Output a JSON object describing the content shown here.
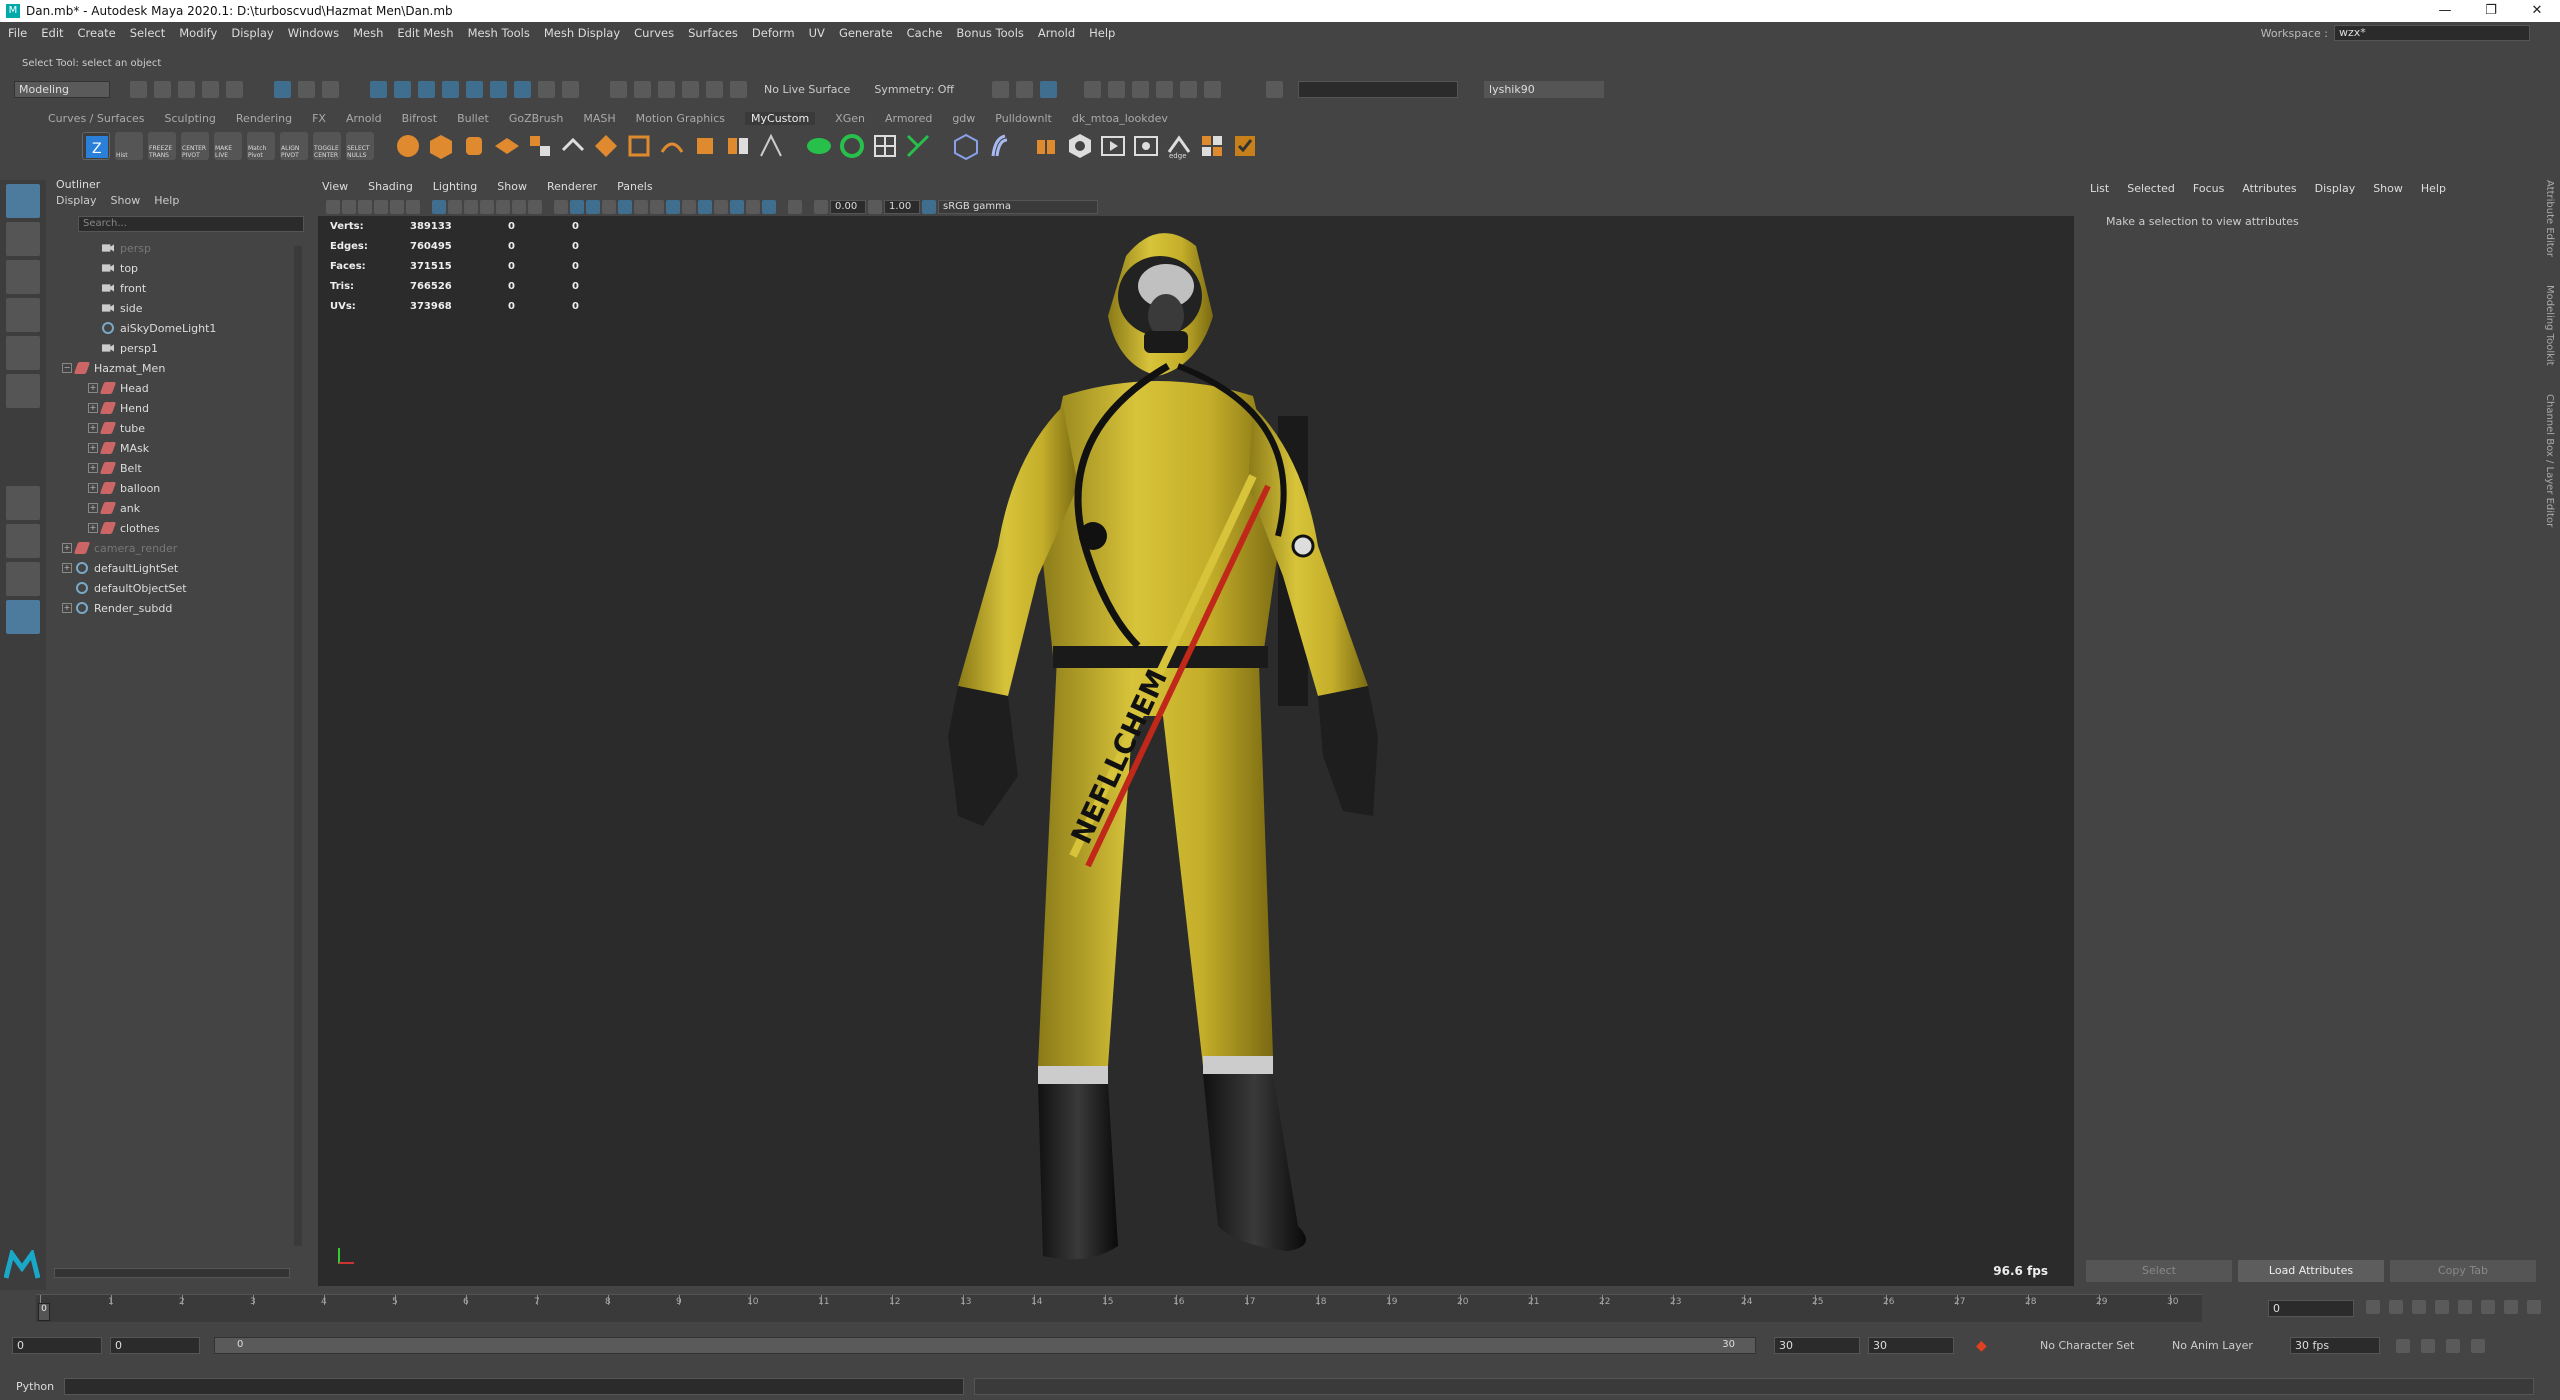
{
  "title": "Dan.mb* - Autodesk Maya 2020.1: D:\\turboscvud\\Hazmat Men\\Dan.mb",
  "window_buttons": {
    "minimize": "—",
    "maximize": "❐",
    "close": "✕"
  },
  "menus": [
    "File",
    "Edit",
    "Create",
    "Select",
    "Modify",
    "Display",
    "Windows",
    "Mesh",
    "Edit Mesh",
    "Mesh Tools",
    "Mesh Display",
    "Curves",
    "Surfaces",
    "Deform",
    "UV",
    "Generate",
    "Cache",
    "Bonus Tools",
    "Arnold",
    "Help"
  ],
  "workspace": {
    "label": "Workspace :",
    "value": "wzx*"
  },
  "help_line": "Select Tool: select an object",
  "status": {
    "mode": "Modeling",
    "live_surface": "No Live Surface",
    "symmetry": "Symmetry: Off",
    "user": "lyshik90"
  },
  "shelf_tabs": [
    "Curves / Surfaces",
    "Sculpting",
    "Rendering",
    "FX",
    "Arnold",
    "Bifrost",
    "Bullet",
    "GoZBrush",
    "MASH",
    "Motion Graphics",
    "MyCustom",
    "XGen",
    "Armored",
    "gdw",
    "Pulldownlt",
    "dk_mtoa_lookdev"
  ],
  "active_shelf": "MyCustom",
  "shelf_labels": [
    "Hist",
    "FREEZE TRANS",
    "CENTER PIVOT",
    "MAKE LIVE",
    "Match Pivot",
    "ALIGN PIVOT",
    "TOGGLE CENTER",
    "SELECT NULLS",
    "edge"
  ],
  "outliner": {
    "title": "Outliner",
    "menu": [
      "Display",
      "Show",
      "Help"
    ],
    "search_placeholder": "Search...",
    "items": [
      {
        "label": "persp",
        "type": "camera",
        "indent": 1,
        "dim": true
      },
      {
        "label": "top",
        "type": "camera",
        "indent": 1
      },
      {
        "label": "front",
        "type": "camera",
        "indent": 1
      },
      {
        "label": "side",
        "type": "camera",
        "indent": 1
      },
      {
        "label": "aiSkyDomeLight1",
        "type": "light",
        "indent": 1
      },
      {
        "label": "persp1",
        "type": "camera",
        "indent": 1
      },
      {
        "label": "Hazmat_Men",
        "type": "mesh",
        "indent": 0,
        "expand": "−"
      },
      {
        "label": "Head",
        "type": "mesh",
        "indent": 1,
        "expand": "+"
      },
      {
        "label": "Hend",
        "type": "mesh",
        "indent": 1,
        "expand": "+"
      },
      {
        "label": "tube",
        "type": "mesh",
        "indent": 1,
        "expand": "+"
      },
      {
        "label": "MAsk",
        "type": "mesh",
        "indent": 1,
        "expand": "+"
      },
      {
        "label": "Belt",
        "type": "mesh",
        "indent": 1,
        "expand": "+"
      },
      {
        "label": "balloon",
        "type": "mesh",
        "indent": 1,
        "expand": "+"
      },
      {
        "label": "ank",
        "type": "mesh",
        "indent": 1,
        "expand": "+"
      },
      {
        "label": "clothes",
        "type": "mesh",
        "indent": 1,
        "expand": "+"
      },
      {
        "label": "camera_render",
        "type": "mesh",
        "indent": 0,
        "expand": "+",
        "dim": true
      },
      {
        "label": "defaultLightSet",
        "type": "set",
        "indent": 0,
        "expand": "+"
      },
      {
        "label": "defaultObjectSet",
        "type": "set",
        "indent": 0
      },
      {
        "label": "Render_subdd",
        "type": "set",
        "indent": 0,
        "expand": "+"
      }
    ]
  },
  "viewport": {
    "menu": [
      "View",
      "Shading",
      "Lighting",
      "Show",
      "Renderer",
      "Panels"
    ],
    "exposure": "0.00",
    "gamma": "1.00",
    "color_space": "sRGB gamma",
    "fps": "96.6 fps",
    "hud": [
      {
        "label": "Verts:",
        "v1": "389133",
        "v2": "0",
        "v3": "0"
      },
      {
        "label": "Edges:",
        "v1": "760495",
        "v2": "0",
        "v3": "0"
      },
      {
        "label": "Faces:",
        "v1": "371515",
        "v2": "0",
        "v3": "0"
      },
      {
        "label": "Tris:",
        "v1": "766526",
        "v2": "0",
        "v3": "0"
      },
      {
        "label": "UVs:",
        "v1": "373968",
        "v2": "0",
        "v3": "0"
      }
    ],
    "suit_text": "NEFLLCHEM"
  },
  "attribute_editor": {
    "menu": [
      "List",
      "Selected",
      "Focus",
      "Attributes",
      "Display",
      "Show",
      "Help"
    ],
    "message": "Make a selection to view attributes",
    "buttons": [
      "Select",
      "Load Attributes",
      "Copy Tab"
    ],
    "side_tabs": [
      "Attribute Editor",
      "Modeling Toolkit",
      "Channel Box / Layer Editor"
    ]
  },
  "timeline": {
    "ticks": [
      "0",
      "1",
      "2",
      "3",
      "4",
      "5",
      "6",
      "7",
      "8",
      "9",
      "10",
      "11",
      "12",
      "13",
      "14",
      "15",
      "16",
      "17",
      "18",
      "19",
      "20",
      "21",
      "22",
      "23",
      "24",
      "25",
      "26",
      "27",
      "28",
      "29",
      "30"
    ],
    "current_frame": "0",
    "playhead_label": "0"
  },
  "range": {
    "start": "0",
    "playback_start": "0",
    "range_start": "0",
    "range_end": "30",
    "playback_end": "30",
    "end": "30",
    "char_set": "No Character Set",
    "anim_layer": "No Anim Layer",
    "fps": "30 fps"
  },
  "command_line": {
    "language": "Python"
  }
}
